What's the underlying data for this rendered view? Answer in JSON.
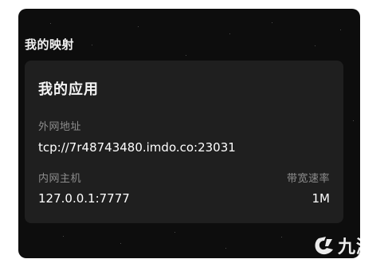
{
  "section": {
    "title": "我的映射"
  },
  "card": {
    "title": "我的应用",
    "external_address_label": "外网地址",
    "external_address_value": "tcp://7r48743480.imdo.co:23031",
    "internal_host_label": "内网主机",
    "internal_host_value": "127.0.0.1:7777",
    "bandwidth_label": "带宽速率",
    "bandwidth_value": "1M"
  },
  "watermark": {
    "text": "九游",
    "icon": "jiuyou-logo-icon"
  },
  "colors": {
    "panel_background": "#0d0d0d",
    "card_background": "#1f1f1f",
    "text_primary": "#ffffff",
    "text_secondary": "#8d8d8d"
  }
}
